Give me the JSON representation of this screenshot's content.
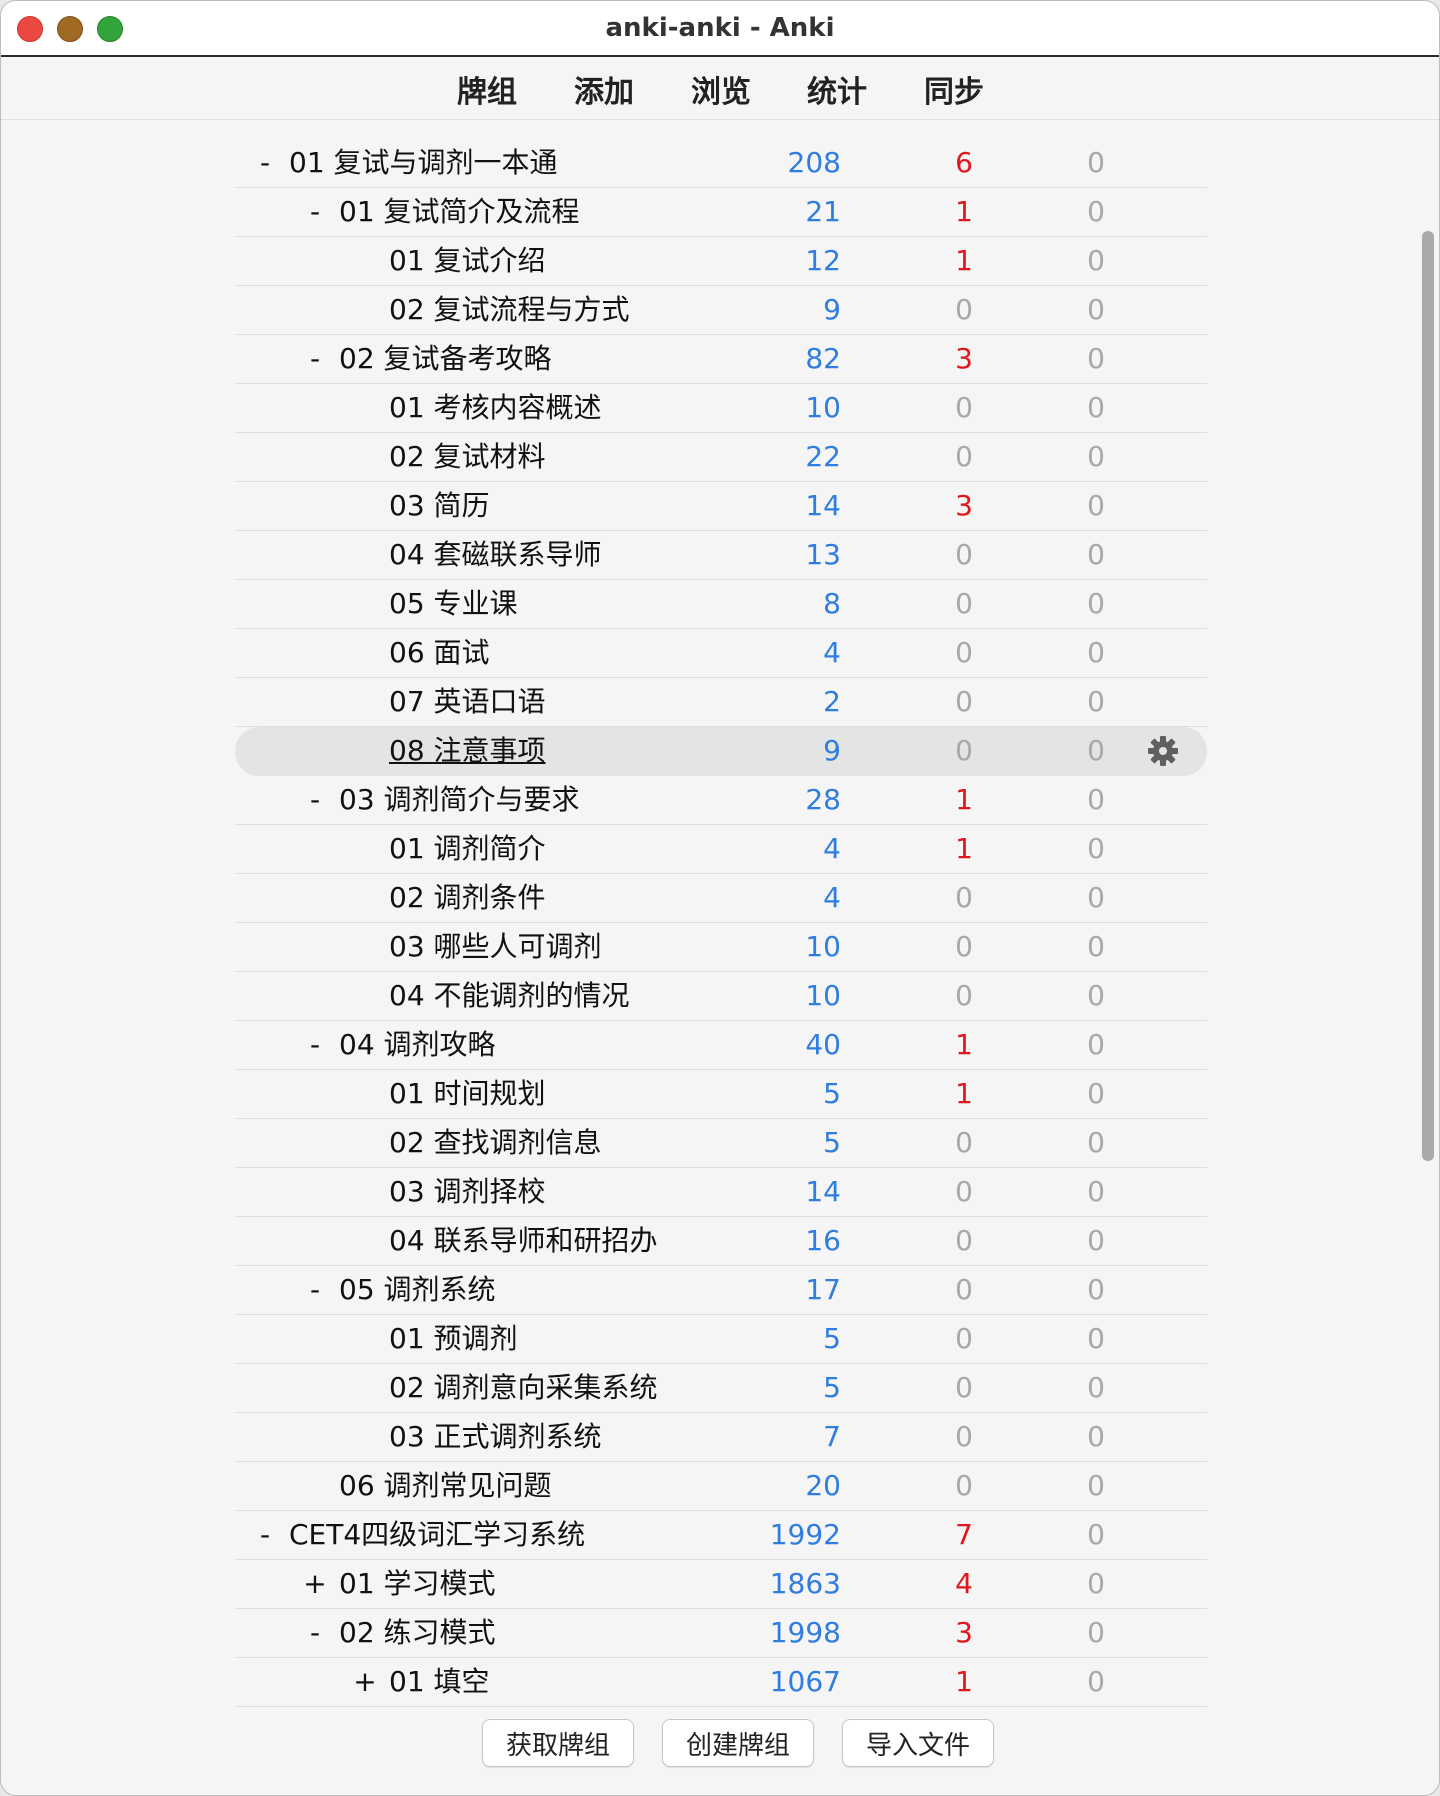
{
  "window": {
    "title": "anki-anki - Anki"
  },
  "toolbar": {
    "tabs": [
      "牌组",
      "添加",
      "浏览",
      "统计",
      "同步"
    ]
  },
  "colors": {
    "due": "#2f7de1",
    "learn_active": "#e0161c",
    "zero": "#a8a8a8"
  },
  "decks": [
    {
      "level": 0,
      "expander": "-",
      "name": "01 复试与调剂一本通",
      "due": "208",
      "learn": "6",
      "new": "0"
    },
    {
      "level": 1,
      "expander": "-",
      "name": "01 复试简介及流程",
      "due": "21",
      "learn": "1",
      "new": "0"
    },
    {
      "level": 2,
      "expander": "",
      "name": "01 复试介绍",
      "due": "12",
      "learn": "1",
      "new": "0"
    },
    {
      "level": 2,
      "expander": "",
      "name": "02 复试流程与方式",
      "due": "9",
      "learn": "0",
      "new": "0"
    },
    {
      "level": 1,
      "expander": "-",
      "name": "02 复试备考攻略",
      "due": "82",
      "learn": "3",
      "new": "0"
    },
    {
      "level": 2,
      "expander": "",
      "name": "01 考核内容概述",
      "due": "10",
      "learn": "0",
      "new": "0"
    },
    {
      "level": 2,
      "expander": "",
      "name": "02 复试材料",
      "due": "22",
      "learn": "0",
      "new": "0"
    },
    {
      "level": 2,
      "expander": "",
      "name": "03 简历",
      "due": "14",
      "learn": "3",
      "new": "0"
    },
    {
      "level": 2,
      "expander": "",
      "name": "04 套磁联系导师",
      "due": "13",
      "learn": "0",
      "new": "0"
    },
    {
      "level": 2,
      "expander": "",
      "name": "05 专业课",
      "due": "8",
      "learn": "0",
      "new": "0"
    },
    {
      "level": 2,
      "expander": "",
      "name": "06 面试",
      "due": "4",
      "learn": "0",
      "new": "0"
    },
    {
      "level": 2,
      "expander": "",
      "name": "07 英语口语",
      "due": "2",
      "learn": "0",
      "new": "0"
    },
    {
      "level": 2,
      "expander": "",
      "name": "08 注意事项",
      "due": "9",
      "learn": "0",
      "new": "0",
      "current": true
    },
    {
      "level": 1,
      "expander": "-",
      "name": "03 调剂简介与要求",
      "due": "28",
      "learn": "1",
      "new": "0"
    },
    {
      "level": 2,
      "expander": "",
      "name": "01 调剂简介",
      "due": "4",
      "learn": "1",
      "new": "0"
    },
    {
      "level": 2,
      "expander": "",
      "name": "02 调剂条件",
      "due": "4",
      "learn": "0",
      "new": "0"
    },
    {
      "level": 2,
      "expander": "",
      "name": "03 哪些人可调剂",
      "due": "10",
      "learn": "0",
      "new": "0"
    },
    {
      "level": 2,
      "expander": "",
      "name": "04 不能调剂的情况",
      "due": "10",
      "learn": "0",
      "new": "0"
    },
    {
      "level": 1,
      "expander": "-",
      "name": "04 调剂攻略",
      "due": "40",
      "learn": "1",
      "new": "0"
    },
    {
      "level": 2,
      "expander": "",
      "name": "01 时间规划",
      "due": "5",
      "learn": "1",
      "new": "0"
    },
    {
      "level": 2,
      "expander": "",
      "name": "02 查找调剂信息",
      "due": "5",
      "learn": "0",
      "new": "0"
    },
    {
      "level": 2,
      "expander": "",
      "name": "03 调剂择校",
      "due": "14",
      "learn": "0",
      "new": "0"
    },
    {
      "level": 2,
      "expander": "",
      "name": "04 联系导师和研招办",
      "due": "16",
      "learn": "0",
      "new": "0"
    },
    {
      "level": 1,
      "expander": "-",
      "name": "05 调剂系统",
      "due": "17",
      "learn": "0",
      "new": "0"
    },
    {
      "level": 2,
      "expander": "",
      "name": "01 预调剂",
      "due": "5",
      "learn": "0",
      "new": "0"
    },
    {
      "level": 2,
      "expander": "",
      "name": "02 调剂意向采集系统",
      "due": "5",
      "learn": "0",
      "new": "0"
    },
    {
      "level": 2,
      "expander": "",
      "name": "03 正式调剂系统",
      "due": "7",
      "learn": "0",
      "new": "0"
    },
    {
      "level": 1,
      "expander": "",
      "name": "06 调剂常见问题",
      "due": "20",
      "learn": "0",
      "new": "0"
    },
    {
      "level": 0,
      "expander": "-",
      "name": "CET4四级词汇学习系统",
      "due": "1992",
      "learn": "7",
      "new": "0"
    },
    {
      "level": 1,
      "expander": "+",
      "name": "01 学习模式",
      "due": "1863",
      "learn": "4",
      "new": "0"
    },
    {
      "level": 1,
      "expander": "-",
      "name": "02 练习模式",
      "due": "1998",
      "learn": "3",
      "new": "0"
    },
    {
      "level": 2,
      "expander": "+",
      "name": "01 填空",
      "due": "1067",
      "learn": "1",
      "new": "0"
    }
  ],
  "buttons": {
    "get_shared": "获取牌组",
    "create_deck": "创建牌组",
    "import_file": "导入文件"
  },
  "icons": {
    "options": "gear-icon"
  }
}
